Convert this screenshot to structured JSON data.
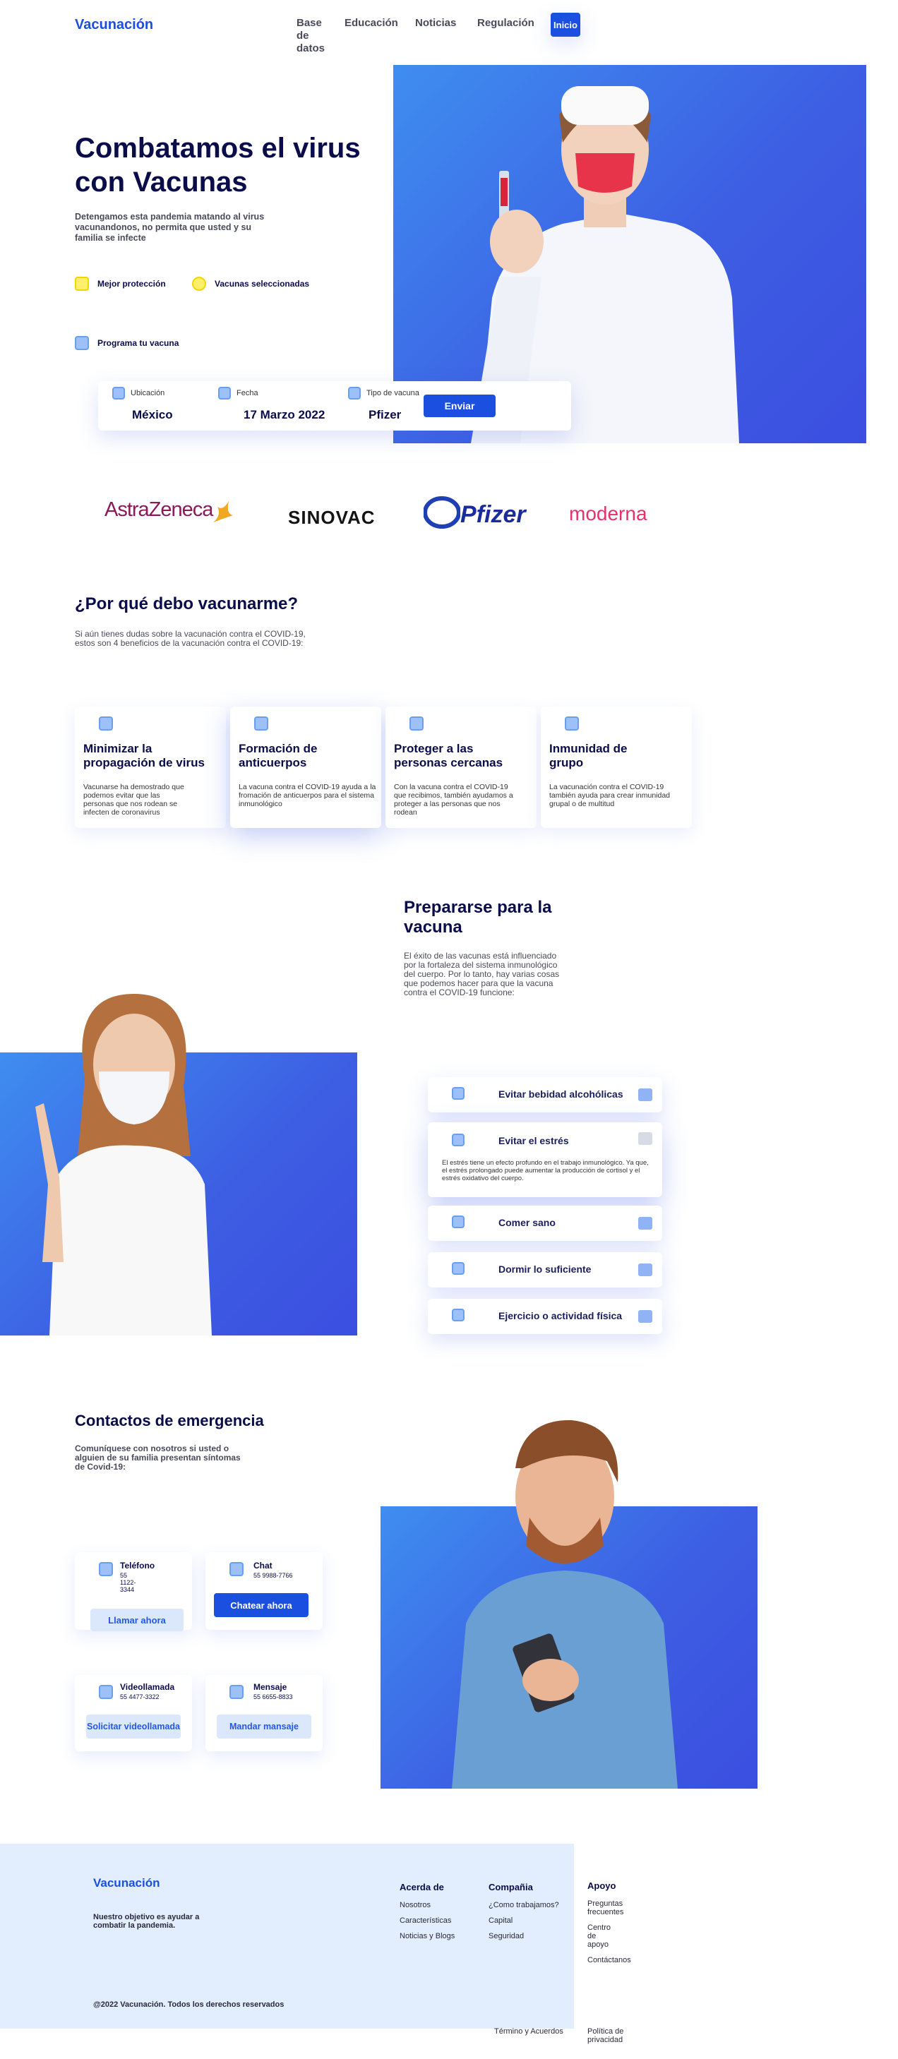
{
  "nav": {
    "logo": "Vacunación",
    "items": [
      "Base de datos",
      "Educación",
      "Noticias",
      "Regulación"
    ],
    "cta": "Inicio"
  },
  "hero": {
    "title": "Combatamos el virus con Vacunas",
    "subtitle": "Detengamos esta pandemia matando al virus vacunandonos, no permita que usted y su familia se infecte",
    "features": [
      "Mejor protección",
      "Vacunas seleccionadas",
      "Programa tu vacuna"
    ]
  },
  "booking": {
    "location_label": "Ubicación",
    "location_value": "México",
    "date_label": "Fecha",
    "date_value": "17 Marzo 2022",
    "type_label": "Tipo de vacuna",
    "type_value": "Pfizer",
    "submit": "Enviar"
  },
  "brands": [
    "AstraZeneca",
    "SINOVAC",
    "Pfizer",
    "moderna"
  ],
  "why": {
    "title": "¿Por qué debo vacunarme?",
    "desc": "Si aún tienes dudas sobre la vacunación contra el COVID-19, estos son 4 beneficios de la vacunación contra el COVID-19:",
    "cards": [
      {
        "title": "Minimizar la propagación de virus",
        "text": "Vacunarse ha demostrado que podemos evitar que las personas que nos rodean se infecten de coronavirus"
      },
      {
        "title": "Formación de anticuerpos",
        "text": "La vacuna contra el COVID-19 ayuda a la fromación de anticuerpos para el sistema inmunológico"
      },
      {
        "title": "Proteger a las personas cercanas",
        "text": "Con la vacuna contra el COVID-19 que recibimos, también ayudamos a proteger a las personas que nos rodean"
      },
      {
        "title": "Inmunidad de grupo",
        "text": "La vacunación contra el COVID-19 también ayuda para crear inmunidad grupal o de multitud"
      }
    ]
  },
  "prepare": {
    "title": "Prepararse para la vacuna",
    "desc": "El éxito de las vacunas está influenciado por la fortaleza del sistema inmunológico del cuerpo. Por lo tanto, hay varias cosas que podemos hacer para que la vacuna contra el COVID-19 funcione:",
    "items": [
      {
        "title": "Evitar bebidad alcohólicas"
      },
      {
        "title": "Evitar el estrés",
        "text": "El estrés tiene un efecto profundo en el trabajo inmunológico. Ya que, el estrés prolongado puede aumentar la producción de cortisol y el estrés oxidativo del cuerpo."
      },
      {
        "title": "Comer sano"
      },
      {
        "title": "Dormir lo suficiente"
      },
      {
        "title": "Ejercicio o actividad física"
      }
    ]
  },
  "contacts": {
    "title": "Contactos de emergencia",
    "desc": "Comuníquese con nosotros si usted o alguien de su familia presentan síntomas de Covid-19:",
    "cards": [
      {
        "title": "Teléfono",
        "value": "55 1122-3344",
        "button": "Llamar ahora"
      },
      {
        "title": "Chat",
        "value": "55 9988-7766",
        "button": "Chatear ahora"
      },
      {
        "title": "Videollamada",
        "value": "55 4477-3322",
        "button": "Solicitar videollamada"
      },
      {
        "title": "Mensaje",
        "value": "55 6655-8833",
        "button": "Mandar mansaje"
      }
    ]
  },
  "footer": {
    "logo": "Vacunación",
    "desc": "Nuestro objetivo es ayudar a combatir la pandemia.",
    "copyright": "@2022 Vacunación. Todos los derechos reservados",
    "col1": {
      "title": "Acerda de",
      "links": [
        "Nosotros",
        "Características",
        "Noticias y Blogs"
      ]
    },
    "col2": {
      "title": "Compañia",
      "links": [
        "¿Como trabajamos?",
        "Capital",
        "Seguridad"
      ]
    },
    "col3": {
      "title": "Apoyo",
      "links": [
        "Preguntas frecuentes",
        "Centro de apoyo",
        "Contáctanos"
      ]
    },
    "terms": "Término y Acuerdos",
    "privacy": "Política de privacidad"
  },
  "colors": {
    "primary": "#1a4fe0",
    "dark": "#0b0d4a",
    "light_blue": "#e2edfd",
    "hero_blue": "#3e6ae8"
  }
}
